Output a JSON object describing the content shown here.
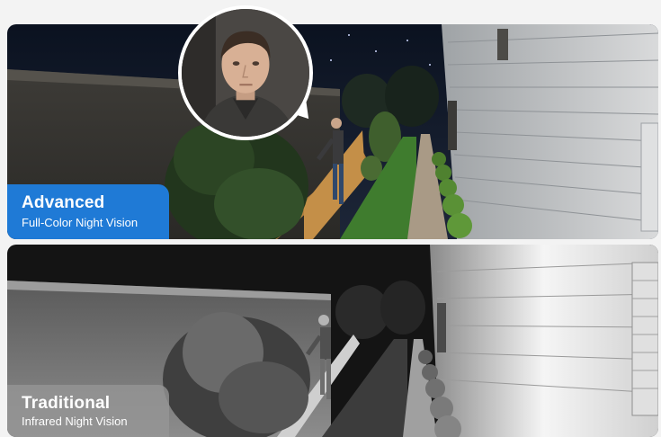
{
  "comparison": {
    "advanced": {
      "title": "Advanced",
      "subtitle": "Full-Color Night Vision",
      "accent": "#1f7ad6"
    },
    "traditional": {
      "title": "Traditional",
      "subtitle": "Infrared Night Vision",
      "accent": "#969696"
    }
  },
  "zoom_inset": {
    "icon": "face-closeup"
  }
}
